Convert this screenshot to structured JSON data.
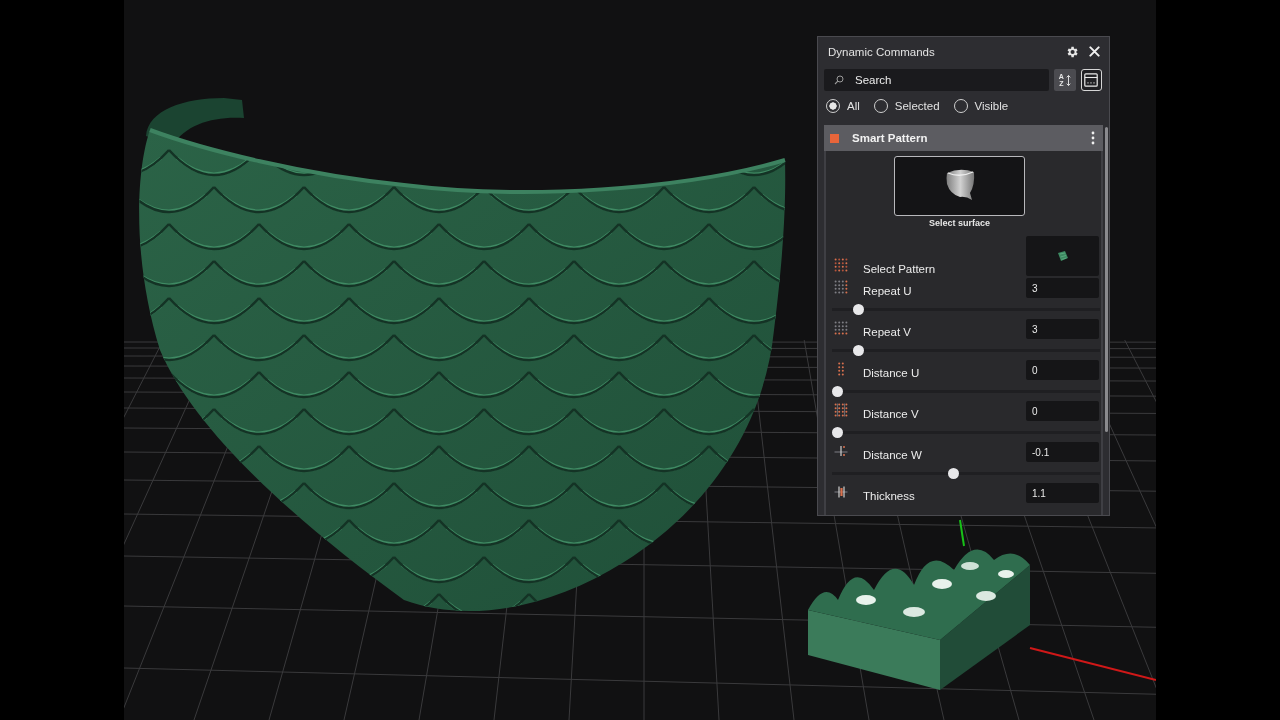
{
  "window": {
    "title": "Dynamic Commands"
  },
  "search": {
    "placeholder": "Search"
  },
  "sort_button": {
    "letters": [
      "A",
      "Z"
    ]
  },
  "filters": [
    {
      "label": "All",
      "selected": true
    },
    {
      "label": "Selected",
      "selected": false
    },
    {
      "label": "Visible",
      "selected": false
    }
  ],
  "section": {
    "title": "Smart Pattern"
  },
  "surface": {
    "caption": "Select surface"
  },
  "parameters": [
    {
      "kind": "picker",
      "label": "Select Pattern"
    },
    {
      "kind": "slider",
      "label": "Repeat U",
      "value": "3",
      "level": 0.08
    },
    {
      "kind": "slider",
      "label": "Repeat V",
      "value": "3",
      "level": 0.08
    },
    {
      "kind": "slider",
      "label": "Distance U",
      "value": "0",
      "level": 0
    },
    {
      "kind": "slider",
      "label": "Distance V",
      "value": "0",
      "level": 0
    },
    {
      "kind": "slider",
      "label": "Distance W",
      "value": "-0.1",
      "level": 0.45
    },
    {
      "kind": "field",
      "label": "Thickness",
      "value": "1.1"
    }
  ]
}
